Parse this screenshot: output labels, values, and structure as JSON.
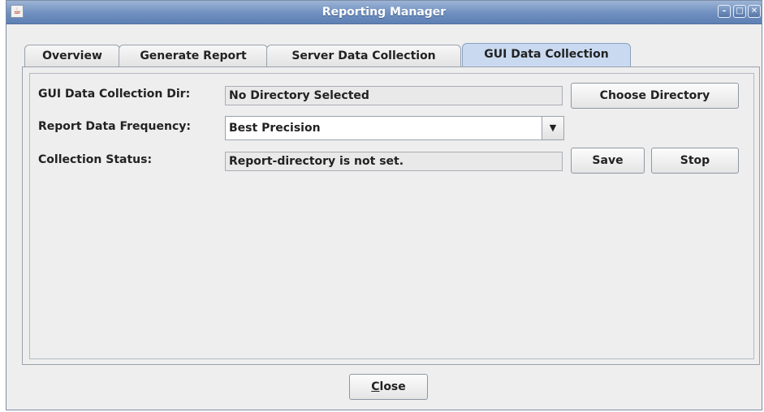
{
  "window": {
    "title": "Reporting Manager",
    "icon": "java-cup-icon",
    "controls": [
      "minimize-icon",
      "maximize-icon",
      "close-icon"
    ]
  },
  "tabs": [
    {
      "label": "Overview",
      "active": false
    },
    {
      "label": "Generate Report",
      "active": false
    },
    {
      "label": "Server Data Collection",
      "active": false
    },
    {
      "label": "GUI Data Collection",
      "active": true
    }
  ],
  "form": {
    "dir_label": "GUI Data Collection Dir:",
    "dir_value": "No Directory Selected",
    "choose_button": "Choose Directory",
    "freq_label": "Report Data Frequency:",
    "freq_value": "Best Precision",
    "status_label": "Collection Status:",
    "status_value": "Report-directory is not set.",
    "save_button": "Save",
    "stop_button": "Stop"
  },
  "footer": {
    "close_first": "C",
    "close_rest": "lose"
  }
}
